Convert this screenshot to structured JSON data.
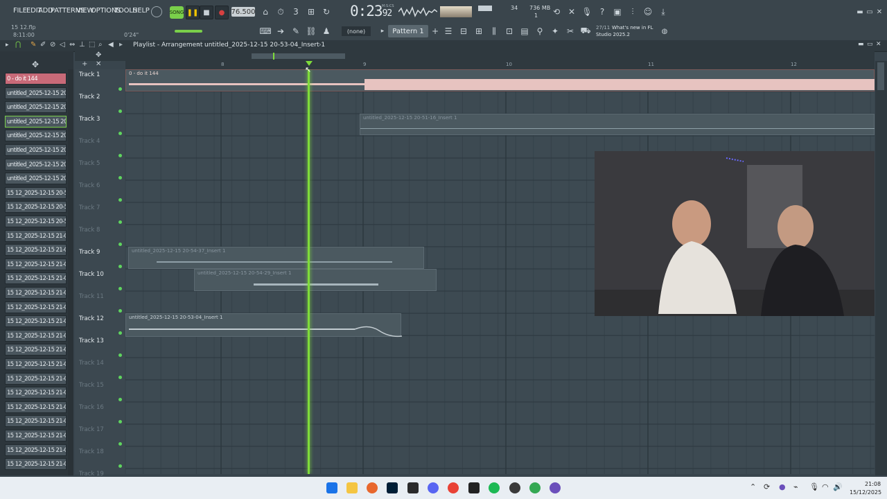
{
  "menu": [
    "FILE",
    "EDIT",
    "ADD",
    "PATTERNS",
    "VIEW",
    "OPTIONS",
    "TOOLS",
    "HELP"
  ],
  "transport": {
    "song_label": "SONG",
    "tempo": "76.500",
    "time_main": "0:23",
    "time_small": "92",
    "time_unit": "M:S:CS",
    "cpu": "34",
    "memory": "736 MB",
    "voices": "1"
  },
  "hint": {
    "file": "15 12.flp",
    "time": "8:11:00",
    "offset": "0'24\""
  },
  "pattern": {
    "none": "(none)",
    "name": "Pattern 1",
    "news_date": "27/11",
    "news_title": "What's new in FL",
    "news_subtitle": "Studio 2025.2"
  },
  "playlist": {
    "title": "Playlist - Arrangement",
    "clip": "untitled_2025-12-15 20-53-04_Insert 1"
  },
  "browser_items": [
    "0 - do it 144",
    "untitled_2025-12-15 20-...",
    "untitled_2025-12-15 20-...",
    "untitled_2025-12-15 20-...",
    "untitled_2025-12-15 20-...",
    "untitled_2025-12-15 20-...",
    "untitled_2025-12-15 20-...",
    "untitled_2025-12-15 20-...",
    "15 12_2025-12-15 20-57...",
    "15 12_2025-12-15 20-57...",
    "15 12_2025-12-15 20-58...",
    "15 12_2025-12-15 21-00...",
    "15 12_2025-12-15 21-00...",
    "15 12_2025-12-15 21-00...",
    "15 12_2025-12-15 21-01...",
    "15 12_2025-12-15 21-01...",
    "15 12_2025-12-15 21-01...",
    "15 12_2025-12-15 21-01...",
    "15 12_2025-12-15 21-01...",
    "15 12_2025-12-15 21-01...",
    "15 12_2025-12-15 21-01...",
    "15 12_2025-12-15 21-01...",
    "15 12_2025-12-15 21-02...",
    "15 12_2025-12-15 21-02...",
    "15 12_2025-12-15 21-02...",
    "15 12_2025-12-15 21-02...",
    "15 12_2025-12-15 21-02...",
    "15 12_2025-12-15 21-02..."
  ],
  "tracks": [
    "Track 1",
    "Track 2",
    "Track 3",
    "Track 4",
    "Track 5",
    "Track 6",
    "Track 7",
    "Track 8",
    "Track 9",
    "Track 10",
    "Track 11",
    "Track 12",
    "Track 13",
    "Track 14",
    "Track 15",
    "Track 16",
    "Track 17",
    "Track 18",
    "Track 19"
  ],
  "ruler": [
    "8",
    "9",
    "10",
    "11",
    "12"
  ],
  "clips": {
    "track1": "0 - do it 144",
    "track3": "untitled_2025-12-15 20-51-16_Insert 1",
    "track9": "untitled_2025-12-15 20-54-37_Insert 1",
    "track10": "untitled_2025-12-15 20-54-29_Insert 1",
    "track12": "untitled_2025-12-15 20-53-04_Insert 1"
  },
  "clock": {
    "time": "21:08",
    "date": "15/12/2025"
  },
  "colors": {
    "accent": "#5fd45f",
    "playhead": "#7fdc3a",
    "track1_wave": "#e7c3c0"
  }
}
